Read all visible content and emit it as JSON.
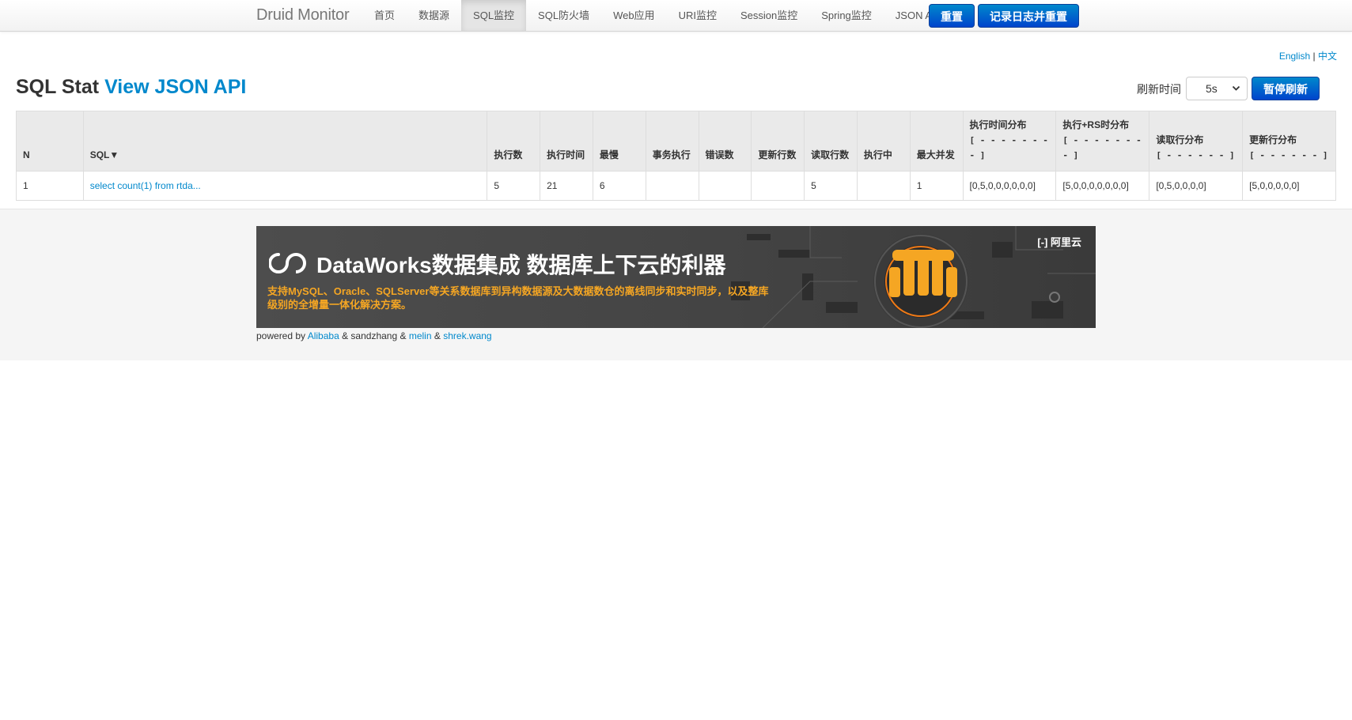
{
  "nav": {
    "brand": "Druid Monitor",
    "items": [
      {
        "label": "首页"
      },
      {
        "label": "数据源"
      },
      {
        "label": "SQL监控",
        "active": true
      },
      {
        "label": "SQL防火墙"
      },
      {
        "label": "Web应用"
      },
      {
        "label": "URI监控"
      },
      {
        "label": "Session监控"
      },
      {
        "label": "Spring监控"
      },
      {
        "label": "JSON API"
      }
    ],
    "reset_label": "重置",
    "log_reset_label": "记录日志并重置",
    "accent_color": "#0044cc"
  },
  "lang": {
    "english": "English",
    "separator": "|",
    "chinese": "中文"
  },
  "page": {
    "title": "SQL Stat",
    "json_api_link": "View JSON API",
    "refresh_label": "刷新时间",
    "refresh_value": "5s",
    "pause_label": "暂停刷新"
  },
  "table": {
    "headers": [
      {
        "label": "N"
      },
      {
        "label": "SQL▼"
      },
      {
        "label": "执行数"
      },
      {
        "label": "执行时间"
      },
      {
        "label": "最慢"
      },
      {
        "label": "事务执行"
      },
      {
        "label": "错误数"
      },
      {
        "label": "更新行数"
      },
      {
        "label": "读取行数"
      },
      {
        "label": "执行中"
      },
      {
        "label": "最大并发"
      },
      {
        "label": "执行时间分布",
        "sub": "[ - - - - - - - - ]"
      },
      {
        "label": "执行+RS时分布",
        "sub": "[ - - - - - - - - ]"
      },
      {
        "label": "读取行分布",
        "sub": "[ - - - - - - ]"
      },
      {
        "label": "更新行分布",
        "sub": "[ - - - - - - ]"
      }
    ],
    "rows": [
      [
        "1",
        "select count(1) from rtda...",
        "5",
        "21",
        "6",
        "",
        "",
        "",
        "5",
        "",
        "1",
        "[0,5,0,0,0,0,0,0]",
        "[5,0,0,0,0,0,0,0]",
        "[0,5,0,0,0,0]",
        "[5,0,0,0,0,0]"
      ]
    ]
  },
  "footer": {
    "banner_title": "DataWorks数据集成 数据库上下云的利器",
    "banner_subtitle": "支持MySQL、Oracle、SQLServer等关系数据库到异构数据源及大数据数仓的离线同步和实时同步，以及整库级别的全增量一体化解决方案。",
    "banner_brand": "阿里云",
    "powered_by": "powered by",
    "alibaba": "Alibaba",
    "sandzhang": "& sandzhang &",
    "melin": "melin",
    "amp": "&",
    "shrek": "shrek.wang"
  }
}
